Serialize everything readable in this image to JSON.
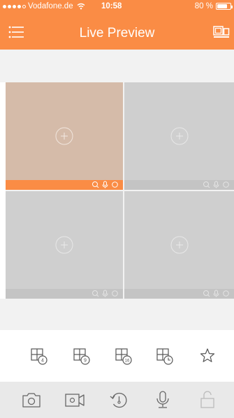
{
  "status_bar": {
    "carrier": "Vodafone.de",
    "time": "10:58",
    "battery": "80 %",
    "battery_level": 0.8
  },
  "nav": {
    "title": "Live Preview",
    "left_icon": "menu-list-icon",
    "right_icon": "channel-layout-icon"
  },
  "colors": {
    "accent": "#fa8c45",
    "selected_cell": "#d5bba9",
    "empty_cell": "#cfcfcf"
  },
  "grid": {
    "cells": [
      {
        "selected": true,
        "icon": "add-camera-icon"
      },
      {
        "selected": false,
        "icon": "add-camera-icon"
      },
      {
        "selected": false,
        "icon": "add-camera-icon"
      },
      {
        "selected": false,
        "icon": "add-camera-icon"
      }
    ],
    "cell_tools": [
      "zoom-icon",
      "mic-icon",
      "record-icon"
    ]
  },
  "split_options": [
    {
      "label": "4",
      "icon": "split-4-icon"
    },
    {
      "label": "9",
      "icon": "split-9-icon"
    },
    {
      "label": "16",
      "icon": "split-16-icon"
    },
    {
      "label": "",
      "icon": "split-history-icon"
    },
    {
      "label": "",
      "icon": "favorite-star-icon"
    }
  ],
  "toolbar": [
    "snapshot-icon",
    "record-video-icon",
    "playback-icon",
    "talk-mic-icon",
    "unlock-icon"
  ]
}
